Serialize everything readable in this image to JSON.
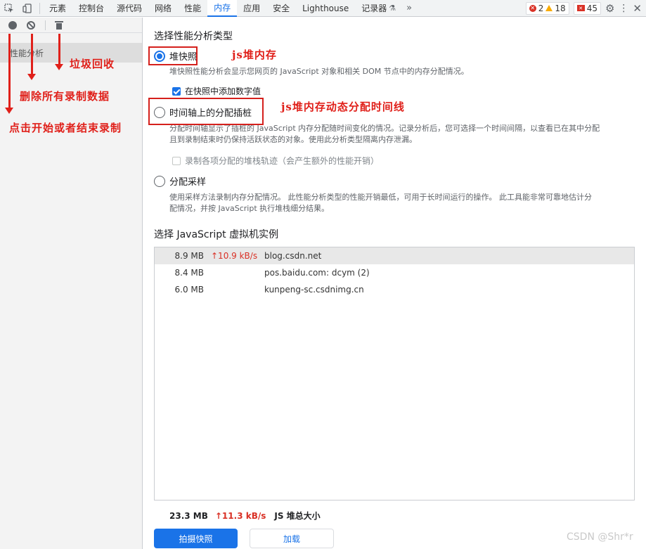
{
  "tabbar": {
    "tabs": [
      "元素",
      "控制台",
      "源代码",
      "网络",
      "性能",
      "内存",
      "应用",
      "安全",
      "Lighthouse",
      "记录器"
    ],
    "active_tab": "内存",
    "errors": "2",
    "warnings": "18",
    "issues": "45"
  },
  "sidebar": {
    "item_label": "性能分析"
  },
  "annotations": {
    "garbage": "垃圾回收",
    "delete": "删除所有录制数据",
    "record": "点击开始或者结束录制",
    "heap": "js堆内存",
    "timeline": "js堆内存动态分配时间线"
  },
  "main": {
    "section_title": "选择性能分析类型",
    "options": [
      {
        "label": "堆快照",
        "desc": "堆快照性能分析会显示您网页的 JavaScript 对象和相关 DOM 节点中的内存分配情况。",
        "checkbox": "在快照中添加数字值"
      },
      {
        "label": "时间轴上的分配插桩",
        "desc1": "分配时间轴显示了插桩的 JavaScript 内存分配随时间变化的情况。记录分析后，您可选择一个时间间隔，以查看已在其中分配",
        "desc2": "且到录制结束时仍保持活跃状态的对象。使用此分析类型隔离内存泄漏。",
        "checkbox": "录制各项分配的堆栈轨迹（会产生额外的性能开销）"
      },
      {
        "label": "分配采样",
        "desc1": "使用采样方法录制内存分配情况。 此性能分析类型的性能开销最低，可用于长时间运行的操作。 此工具能非常可靠地估计分",
        "desc2": "配情况，并按 JavaScript 执行堆栈细分结果。"
      }
    ],
    "vm_title": "选择 JavaScript 虚拟机实例",
    "vm_rows": [
      {
        "size": "8.9 MB",
        "rate": "↑10.9 kB/s",
        "name": "blog.csdn.net"
      },
      {
        "size": "8.4 MB",
        "rate": "",
        "name": "pos.baidu.com: dcym (2)"
      },
      {
        "size": "6.0 MB",
        "rate": "",
        "name": "kunpeng-sc.csdnimg.cn"
      }
    ],
    "total_size": "23.3 MB",
    "total_rate": "↑11.3 kB/s",
    "total_label": "JS 堆总大小",
    "snapshot_button": "拍摄快照",
    "load_button": "加载"
  },
  "watermark": "CSDN @Shr*r"
}
